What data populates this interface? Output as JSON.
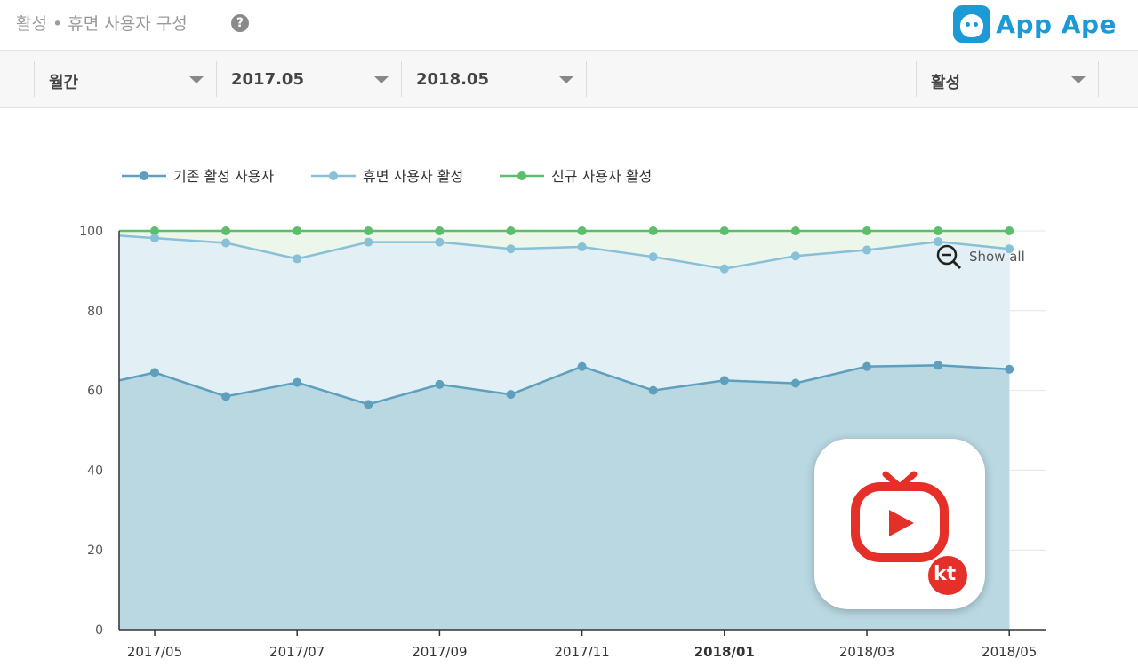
{
  "header": {
    "title": "활성 • 휴면 사용자 구성",
    "help_icon": "question-circle-icon",
    "logo_text": "App Ape",
    "logo_icon": "app-ape-monkey-icon",
    "brand_color": "#1c9ad6"
  },
  "toolbar": {
    "period": "월간",
    "start": "2017.05",
    "end": "2018.05",
    "metric": "활성"
  },
  "zoom": {
    "icon": "zoom-out-icon",
    "label": "Show all"
  },
  "app_icon": {
    "name": "kt-tv-app-icon",
    "badge": "kt",
    "color": "#e53029"
  },
  "chart_data": {
    "type": "area",
    "categories": [
      "2017/04",
      "2017/05",
      "2017/06",
      "2017/07",
      "2017/08",
      "2017/09",
      "2017/10",
      "2017/11",
      "2017/12",
      "2018/01",
      "2018/02",
      "2018/03",
      "2018/04",
      "2018/05"
    ],
    "x_tick_labels": [
      "2017/05",
      "2017/07",
      "2017/09",
      "2017/11",
      "2018/01",
      "2018/03",
      "2018/05"
    ],
    "bold_tick": "2018/01",
    "ylim": [
      0,
      100
    ],
    "yticks": [
      0,
      20,
      40,
      60,
      80,
      100
    ],
    "grid": true,
    "legend_position": "top-left",
    "series": [
      {
        "name": "기존 활성 사용자",
        "color": "#5d9fbd",
        "fill": "#b9d8e2",
        "values": [
          62.5,
          64.5,
          58.5,
          62,
          56.5,
          61.5,
          59,
          66,
          60,
          62.5,
          61.8,
          66,
          66.3,
          65.3
        ]
      },
      {
        "name": "휴면 사용자 활성",
        "color": "#87c0d7",
        "fill": "#e2f0f5",
        "values": [
          98.8,
          98.2,
          97,
          93,
          97.2,
          97.2,
          95.5,
          96,
          93.5,
          90.5,
          93.7,
          95.2,
          97.3,
          95.5
        ]
      },
      {
        "name": "신규 사용자 활성",
        "color": "#5cbd6a",
        "fill": "#edf6ea",
        "values": [
          100,
          100,
          100,
          100,
          100,
          100,
          100,
          100,
          100,
          100,
          100,
          100,
          100,
          100
        ]
      }
    ]
  }
}
